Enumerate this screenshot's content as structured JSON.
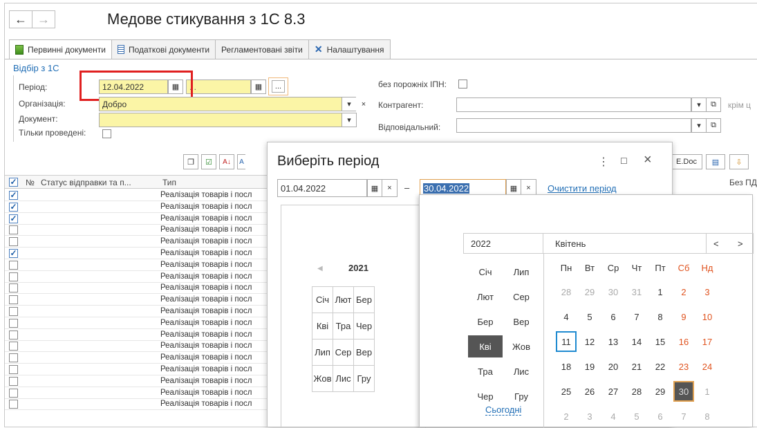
{
  "app": {
    "title": "Медове стикування з 1С 8.3",
    "back": "←",
    "forward": "→"
  },
  "tabs": [
    {
      "label": "Первинні документи",
      "icon": "green-doc-icon"
    },
    {
      "label": "Податкові документи",
      "icon": "doc-list-icon"
    },
    {
      "label": "Регламентовані звіти"
    },
    {
      "label": "Налаштування",
      "icon": "tools-icon"
    }
  ],
  "filter": {
    "section": "Відбір з 1С",
    "period_label": "Період:",
    "period_from": "12.04.2022",
    "period_to": ". .",
    "more": "...",
    "org_label": "Організація:",
    "org_value": "Добро",
    "doc_label": "Документ:",
    "only_posted_label": "Тільки проведені:",
    "no_empty_ipn_label": "без порожніх ІПН:",
    "counterparty_label": "Контрагент:",
    "responsible_label": "Відповідальний:",
    "except_label": "крім ц"
  },
  "toolbar": {
    "edoc_label": "E.Doc"
  },
  "table": {
    "headers": {
      "check": "",
      "num": "№",
      "status": "Статус відправки та п...",
      "type": "Тип",
      "right": "Без ПД"
    },
    "row_text": "Реалізація товарів і посл",
    "checked": [
      true,
      true,
      true,
      false,
      false,
      true,
      false,
      false,
      false,
      false,
      false,
      false,
      false,
      false,
      false,
      false,
      false,
      false,
      false
    ]
  },
  "dialog": {
    "title": "Виберіть період",
    "from": "01.04.2022",
    "to": "30.04.2022",
    "dash": "–",
    "clear_link": "Очистити період",
    "left_year": "2021",
    "left_months": [
      "Січ",
      "Лют",
      "Бер",
      "Кві",
      "Тра",
      "Чер",
      "Лип",
      "Сер",
      "Вер",
      "Жов",
      "Лис",
      "Гру"
    ]
  },
  "calendar": {
    "year": "2022",
    "month": "Квітень",
    "months_col1": [
      "Січ",
      "Лют",
      "Бер",
      "Кві",
      "Тра",
      "Чер"
    ],
    "months_col2": [
      "Лип",
      "Сер",
      "Вер",
      "Жов",
      "Лис",
      "Гру"
    ],
    "weekdays": [
      "Пн",
      "Вт",
      "Ср",
      "Чт",
      "Пт",
      "Сб",
      "Нд"
    ],
    "weeks": [
      [
        "28",
        "29",
        "30",
        "31",
        "1",
        "2",
        "3"
      ],
      [
        "4",
        "5",
        "6",
        "7",
        "8",
        "9",
        "10"
      ],
      [
        "11",
        "12",
        "13",
        "14",
        "15",
        "16",
        "17"
      ],
      [
        "18",
        "19",
        "20",
        "21",
        "22",
        "23",
        "24"
      ],
      [
        "25",
        "26",
        "27",
        "28",
        "29",
        "30",
        "1"
      ],
      [
        "2",
        "3",
        "4",
        "5",
        "6",
        "7",
        "8"
      ]
    ],
    "today_link": "Сьогодні",
    "prev": "<",
    "next": ">"
  },
  "colors": {
    "highlight_box": "#e02020",
    "selected_bg": "#555555",
    "accent": "#1f6db5",
    "weekend": "#e0531f",
    "yellow": "#fbf5a6"
  }
}
